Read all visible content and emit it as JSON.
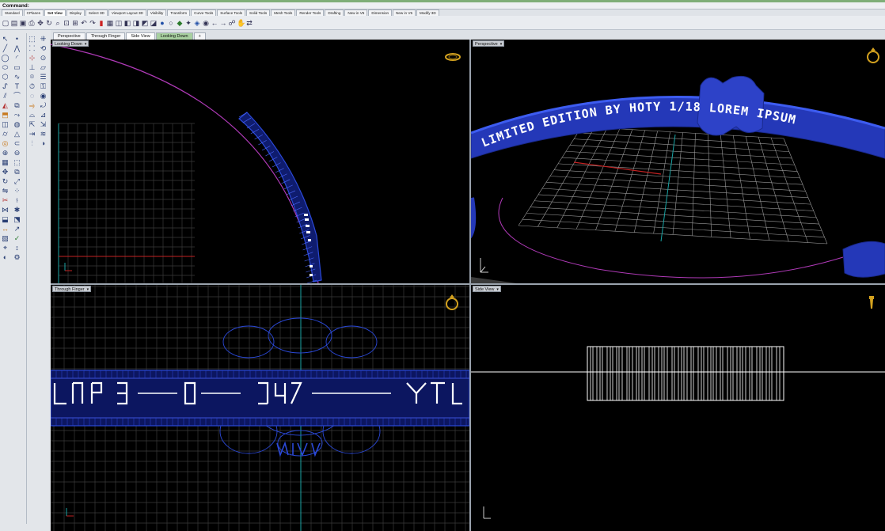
{
  "command": {
    "label": "Command:"
  },
  "toolbar_tabs": [
    {
      "label": "Standard"
    },
    {
      "label": "CPlanes"
    },
    {
      "label": "Set View",
      "active": true
    },
    {
      "label": "Display"
    },
    {
      "label": "Select 3D"
    },
    {
      "label": "Viewport Layout 3D"
    },
    {
      "label": "Visibility"
    },
    {
      "label": "Transform"
    },
    {
      "label": "Curve Tools"
    },
    {
      "label": "Surface Tools"
    },
    {
      "label": "Solid Tools"
    },
    {
      "label": "Mesh Tools"
    },
    {
      "label": "Render Tools"
    },
    {
      "label": "Drafting"
    },
    {
      "label": "New in V5"
    },
    {
      "label": "Dimension"
    },
    {
      "label": "New in V5"
    },
    {
      "label": "Modify 3D"
    }
  ],
  "view_tabs": [
    {
      "label": "Perspective"
    },
    {
      "label": "Through Finger"
    },
    {
      "label": "Side View",
      "active": true
    },
    {
      "label": "Looking Down",
      "highlight": true
    },
    {
      "label": "+"
    }
  ],
  "viewports": {
    "top_left": {
      "label": "Looking Down"
    },
    "top_right": {
      "label": "Perspective",
      "ring_text": "LIMITED EDITION BY HOTY  1/18  LOREM IPSUM"
    },
    "bottom_left": {
      "label": "Through Finger"
    },
    "bottom_right": {
      "label": "Side View"
    }
  },
  "icons": {
    "ring": "ring-icon",
    "gnome": "axis-gnomon-icon"
  },
  "colors": {
    "model_blue": "#2b49d8",
    "curve_magenta": "#b03ab8",
    "axis_red": "#c42222",
    "axis_cyan": "#1aa3a3",
    "grid": "#3c3c3c",
    "ring_icon": "#d4a21f"
  }
}
